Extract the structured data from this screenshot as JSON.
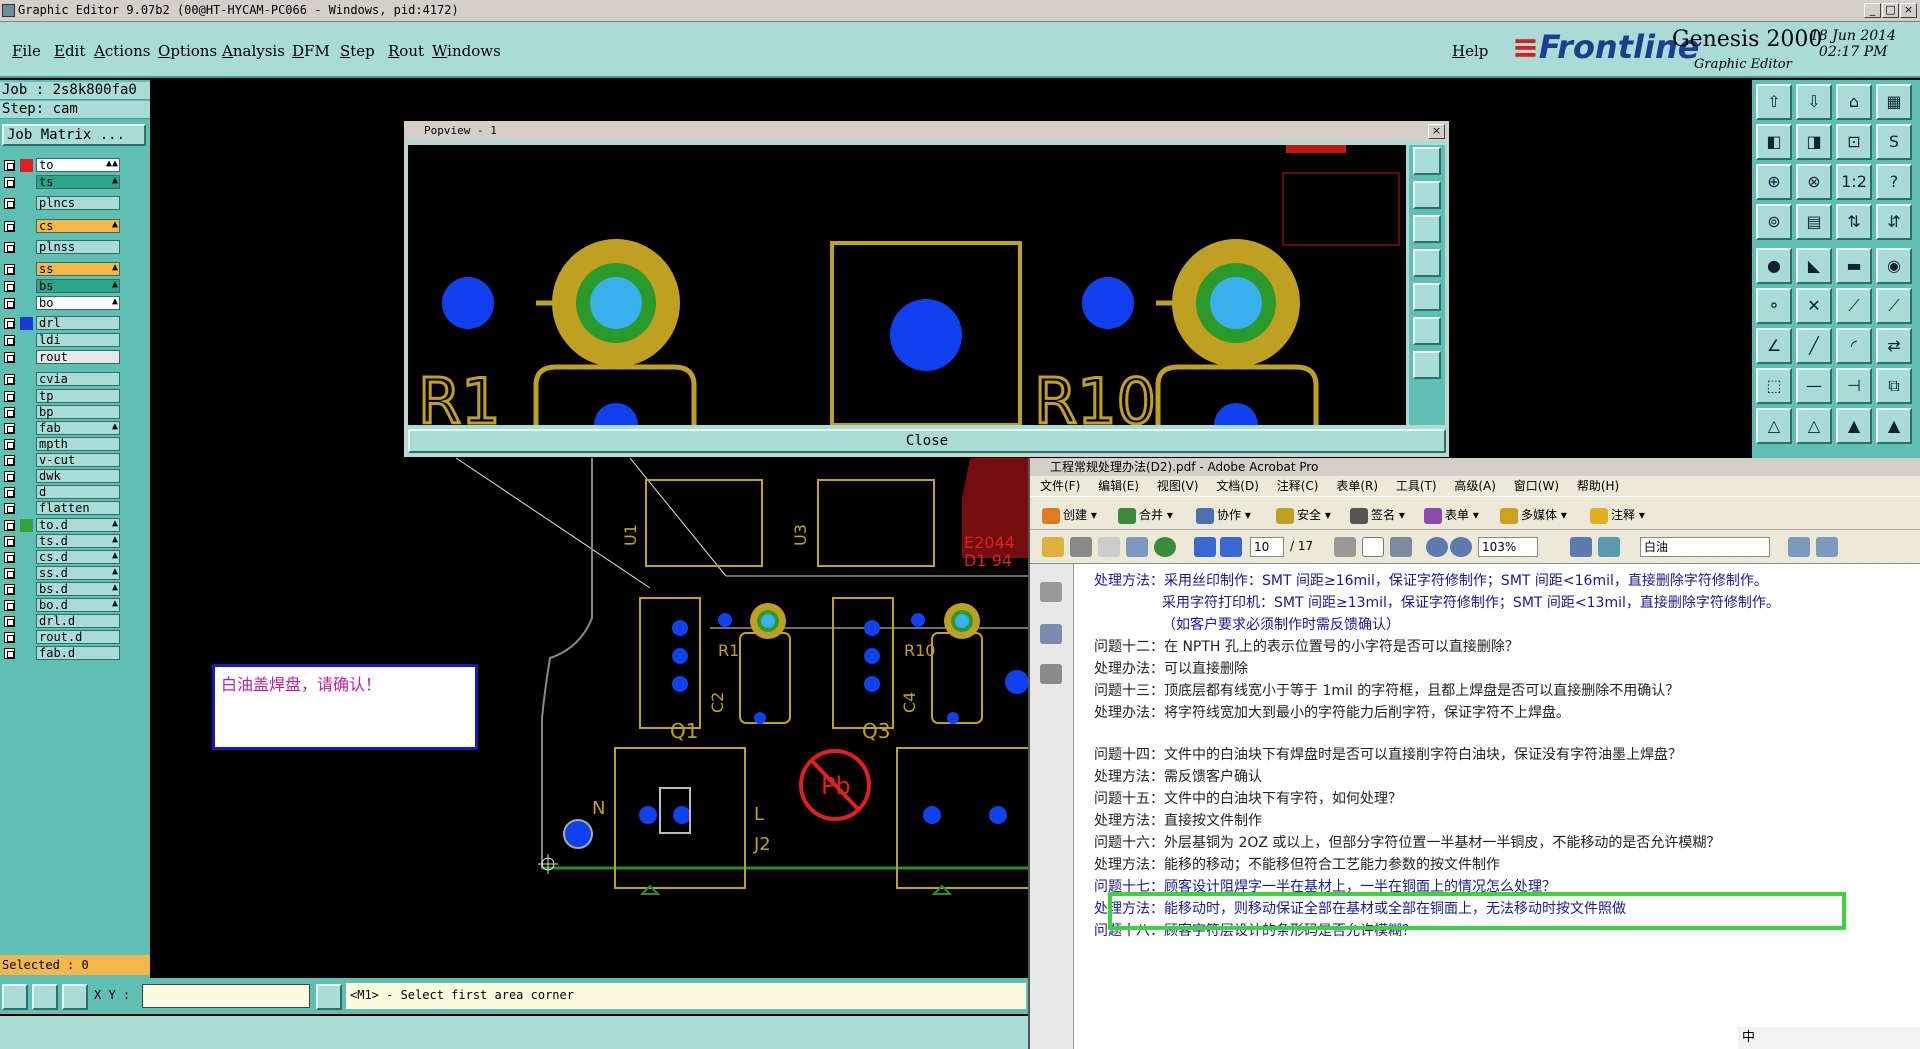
{
  "window": {
    "title": "Graphic Editor 9.07b2 (00@HT-HYCAM-PC066 - Windows, pid:4172)"
  },
  "menu": {
    "items": [
      "File",
      "Edit",
      "Actions",
      "Options",
      "Analysis",
      "DFM",
      "Step",
      "Rout",
      "Windows"
    ],
    "help": "Help"
  },
  "brand": {
    "logo": "Frontline",
    "product": "Genesis 2000",
    "subtitle": "Graphic Editor",
    "date": "18 Jun 2014",
    "time": "02:17 PM"
  },
  "job": {
    "job": "Job : 2s8k800fa0",
    "step": "Step: cam",
    "matrix": "Job Matrix ..."
  },
  "layers": [
    {
      "name": "to",
      "color": "#ffffff",
      "mark": "#e02020",
      "aff": "▲▲"
    },
    {
      "name": "ts",
      "color": "#2aa58a",
      "mark": "",
      "aff": "▲"
    },
    {
      "name": "plncs",
      "color": "#a9dbd7",
      "mark": "",
      "aff": ""
    },
    {
      "name": "cs",
      "color": "#f4b84a",
      "mark": "",
      "aff": "▲"
    },
    {
      "name": "plnss",
      "color": "#a9dbd7",
      "mark": "",
      "aff": ""
    },
    {
      "name": "ss",
      "color": "#f4b84a",
      "mark": "",
      "aff": "▲"
    },
    {
      "name": "bs",
      "color": "#2aa58a",
      "mark": "",
      "aff": "▲"
    },
    {
      "name": "bo",
      "color": "#ffffff",
      "mark": "",
      "aff": "▲"
    },
    {
      "name": "drl",
      "color": "#a9dbd7",
      "mark": "#1a3ae0",
      "aff": ""
    },
    {
      "name": "ldi",
      "color": "#a9dbd7",
      "mark": "",
      "aff": ""
    },
    {
      "name": "rout",
      "color": "#e8e8e8",
      "mark": "",
      "aff": ""
    },
    {
      "name": "cvia",
      "color": "#a9dbd7",
      "mark": "",
      "aff": ""
    },
    {
      "name": "tp",
      "color": "#a9dbd7",
      "mark": "",
      "aff": ""
    },
    {
      "name": "bp",
      "color": "#a9dbd7",
      "mark": "",
      "aff": ""
    },
    {
      "name": "fab",
      "color": "#a9dbd7",
      "mark": "",
      "aff": "▲"
    },
    {
      "name": "mpth",
      "color": "#a9dbd7",
      "mark": "",
      "aff": ""
    },
    {
      "name": "v-cut",
      "color": "#a9dbd7",
      "mark": "",
      "aff": ""
    },
    {
      "name": "dwk",
      "color": "#a9dbd7",
      "mark": "",
      "aff": ""
    },
    {
      "name": "d",
      "color": "#a9dbd7",
      "mark": "",
      "aff": ""
    },
    {
      "name": "flatten",
      "color": "#a9dbd7",
      "mark": "",
      "aff": ""
    },
    {
      "name": "to.d",
      "color": "#a9dbd7",
      "mark": "#3aa03a",
      "aff": "▲"
    },
    {
      "name": "ts.d",
      "color": "#a9dbd7",
      "mark": "",
      "aff": "▲"
    },
    {
      "name": "cs.d",
      "color": "#a9dbd7",
      "mark": "",
      "aff": "▲"
    },
    {
      "name": "ss.d",
      "color": "#a9dbd7",
      "mark": "",
      "aff": "▲"
    },
    {
      "name": "bs.d",
      "color": "#a9dbd7",
      "mark": "",
      "aff": "▲"
    },
    {
      "name": "bo.d",
      "color": "#a9dbd7",
      "mark": "",
      "aff": "▲"
    },
    {
      "name": "drl.d",
      "color": "#a9dbd7",
      "mark": "",
      "aff": ""
    },
    {
      "name": "rout.d",
      "color": "#a9dbd7",
      "mark": "",
      "aff": ""
    },
    {
      "name": "fab.d",
      "color": "#a9dbd7",
      "mark": "",
      "aff": ""
    }
  ],
  "popview": {
    "title": "Popview - 1",
    "close": "Close",
    "labels": [
      "R1",
      "R10"
    ]
  },
  "board": {
    "labels": [
      "U1",
      "U3",
      "R1",
      "R10",
      "C2",
      "C4",
      "Q1",
      "Q3",
      "N",
      "L",
      "J2",
      "Pb",
      "E2044",
      "D1 94"
    ]
  },
  "note": "白油盖焊盘，请确认！",
  "status": {
    "selected": "Selected : 0",
    "xy_label": "X Y :",
    "message": "<M1> - Select first area corner"
  },
  "acrobat": {
    "title": "工程常规处理办法(D2).pdf - Adobe Acrobat Pro",
    "menu": [
      "文件(F)",
      "编辑(E)",
      "视图(V)",
      "文档(D)",
      "注释(C)",
      "表单(R)",
      "工具(T)",
      "高级(A)",
      "窗口(W)",
      "帮助(H)"
    ],
    "toolbar": [
      "创建",
      "合并",
      "协作",
      "安全",
      "签名",
      "表单",
      "多媒体",
      "注释"
    ],
    "page": "10",
    "pages": "/ 17",
    "zoom": "103%",
    "search": "白油",
    "lines": [
      {
        "t": "处理方法：采用丝印制作：SMT 间距≥16mil，保证字符修制作；SMT 间距<16mil，直接删除字符修制作。",
        "c": "q",
        "x": 20
      },
      {
        "t": "采用字符打印机：SMT 间距≥13mil，保证字符修制作；SMT 间距<13mil，直接删除字符修制作。",
        "c": "q",
        "x": 88
      },
      {
        "t": "（如客户要求必须制作时需反馈确认）",
        "c": "q",
        "x": 88
      },
      {
        "t": "问题十二：在 NPTH 孔上的表示位置号的小字符是否可以直接删除？",
        "c": "a",
        "x": 20
      },
      {
        "t": "处理办法：可以直接删除",
        "c": "a",
        "x": 20
      },
      {
        "t": "问题十三：顶底层都有线宽小于等于 1mil 的字符框，且都上焊盘是否可以直接删除不用确认？",
        "c": "a",
        "x": 20
      },
      {
        "t": "处理办法：将字符线宽加大到最小的字符能力后削字符，保证字符不上焊盘。",
        "c": "a",
        "x": 20
      },
      {
        "t": "问题十四：文件中的白油块下有焊盘时是否可以直接削字符白油块，保证没有字符油墨上焊盘？",
        "c": "a",
        "x": 20
      },
      {
        "t": "处理方法：需反馈客户确认",
        "c": "a",
        "x": 20
      },
      {
        "t": "问题十五：文件中的白油块下有字符，如何处理？",
        "c": "a",
        "x": 20
      },
      {
        "t": "处理方法：直接按文件制作",
        "c": "a",
        "x": 20
      },
      {
        "t": "问题十六：外层基铜为 2OZ 或以上，但部分字符位置一半基材一半铜皮，不能移动的是否允许模糊？",
        "c": "a",
        "x": 20
      },
      {
        "t": "处理方法：能移的移动；不能移但符合工艺能力参数的按文件制作",
        "c": "a",
        "x": 20
      },
      {
        "t": "问题十七：顾客设计阻焊字一半在基材上，一半在铜面上的情况怎么处理？",
        "c": "q",
        "x": 20
      },
      {
        "t": "处理方法：能移动时，则移动保证全部在基材或全部在铜面上，无法移动时按文件照做",
        "c": "q",
        "x": 20
      },
      {
        "t": "问题十八：顾客字符层设计的条形码是否允许模糊？",
        "c": "q",
        "x": 20
      }
    ]
  },
  "ime": "中"
}
